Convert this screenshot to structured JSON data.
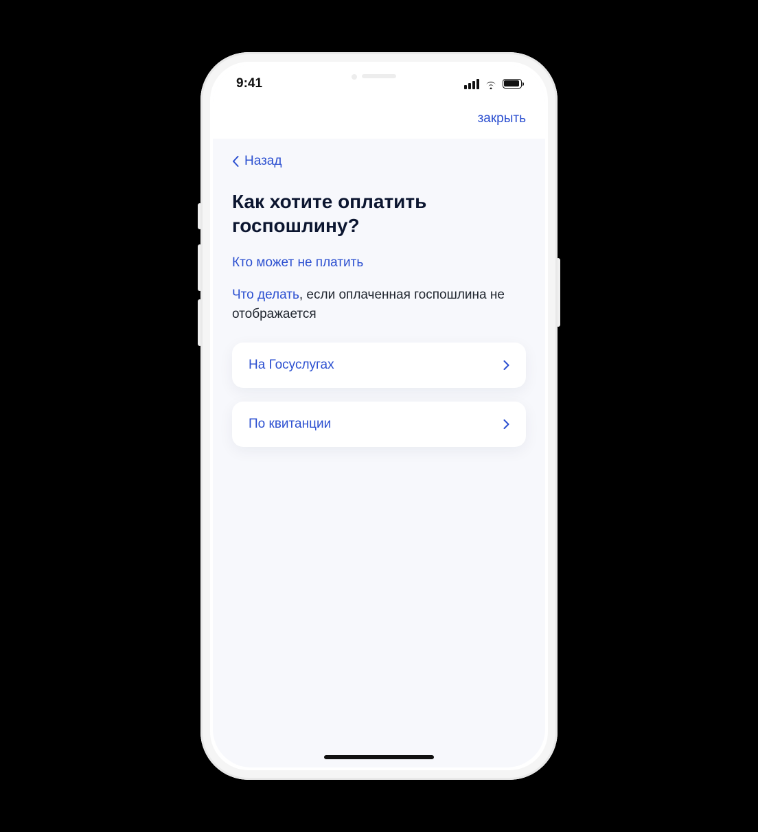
{
  "status": {
    "time": "9:41"
  },
  "header": {
    "close_label": "закрыть"
  },
  "nav": {
    "back_label": "Назад"
  },
  "main": {
    "title": "Как хотите оплатить госпошлину?",
    "who_exempt_link": "Кто может не платить",
    "what_to_do_link": "Что делать",
    "what_to_do_rest": ", если оплаченная госпошлина не отображается"
  },
  "options": [
    {
      "label": "На Госуслугах"
    },
    {
      "label": "По квитанции"
    }
  ]
}
